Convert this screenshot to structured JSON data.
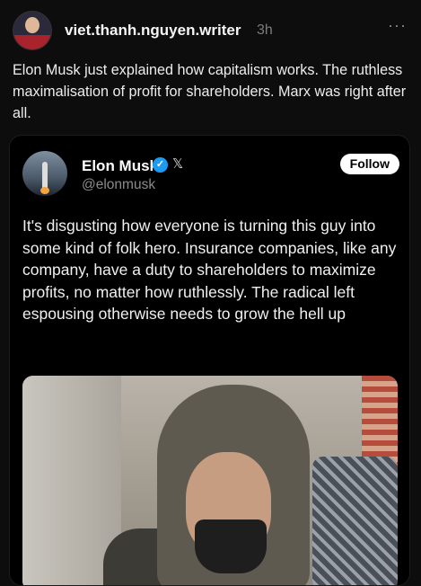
{
  "post": {
    "username": "viet.thanh.nguyen.writer",
    "time": "3h",
    "more_label": "···",
    "text": "Elon Musk just explained how capitalism works. The ruthless maximalisation of profit for shareholders. Marx was right after all."
  },
  "tweet": {
    "name": "Elon Musk",
    "verified_glyph": "✓",
    "x_logo": "𝕏",
    "handle": "@elonmusk",
    "follow_label": "Follow",
    "text": "It's disgusting how everyone is turning this guy into some kind of folk hero. Insurance companies, like any company, have a duty to shareholders to maximize profits, no matter how ruthlessly. The radical left espousing otherwise needs to grow the hell up"
  },
  "colors": {
    "background": "#0d0d0d",
    "verified": "#1d9bf0",
    "follow_bg": "#ffffff",
    "muted": "#8b8b8b"
  }
}
